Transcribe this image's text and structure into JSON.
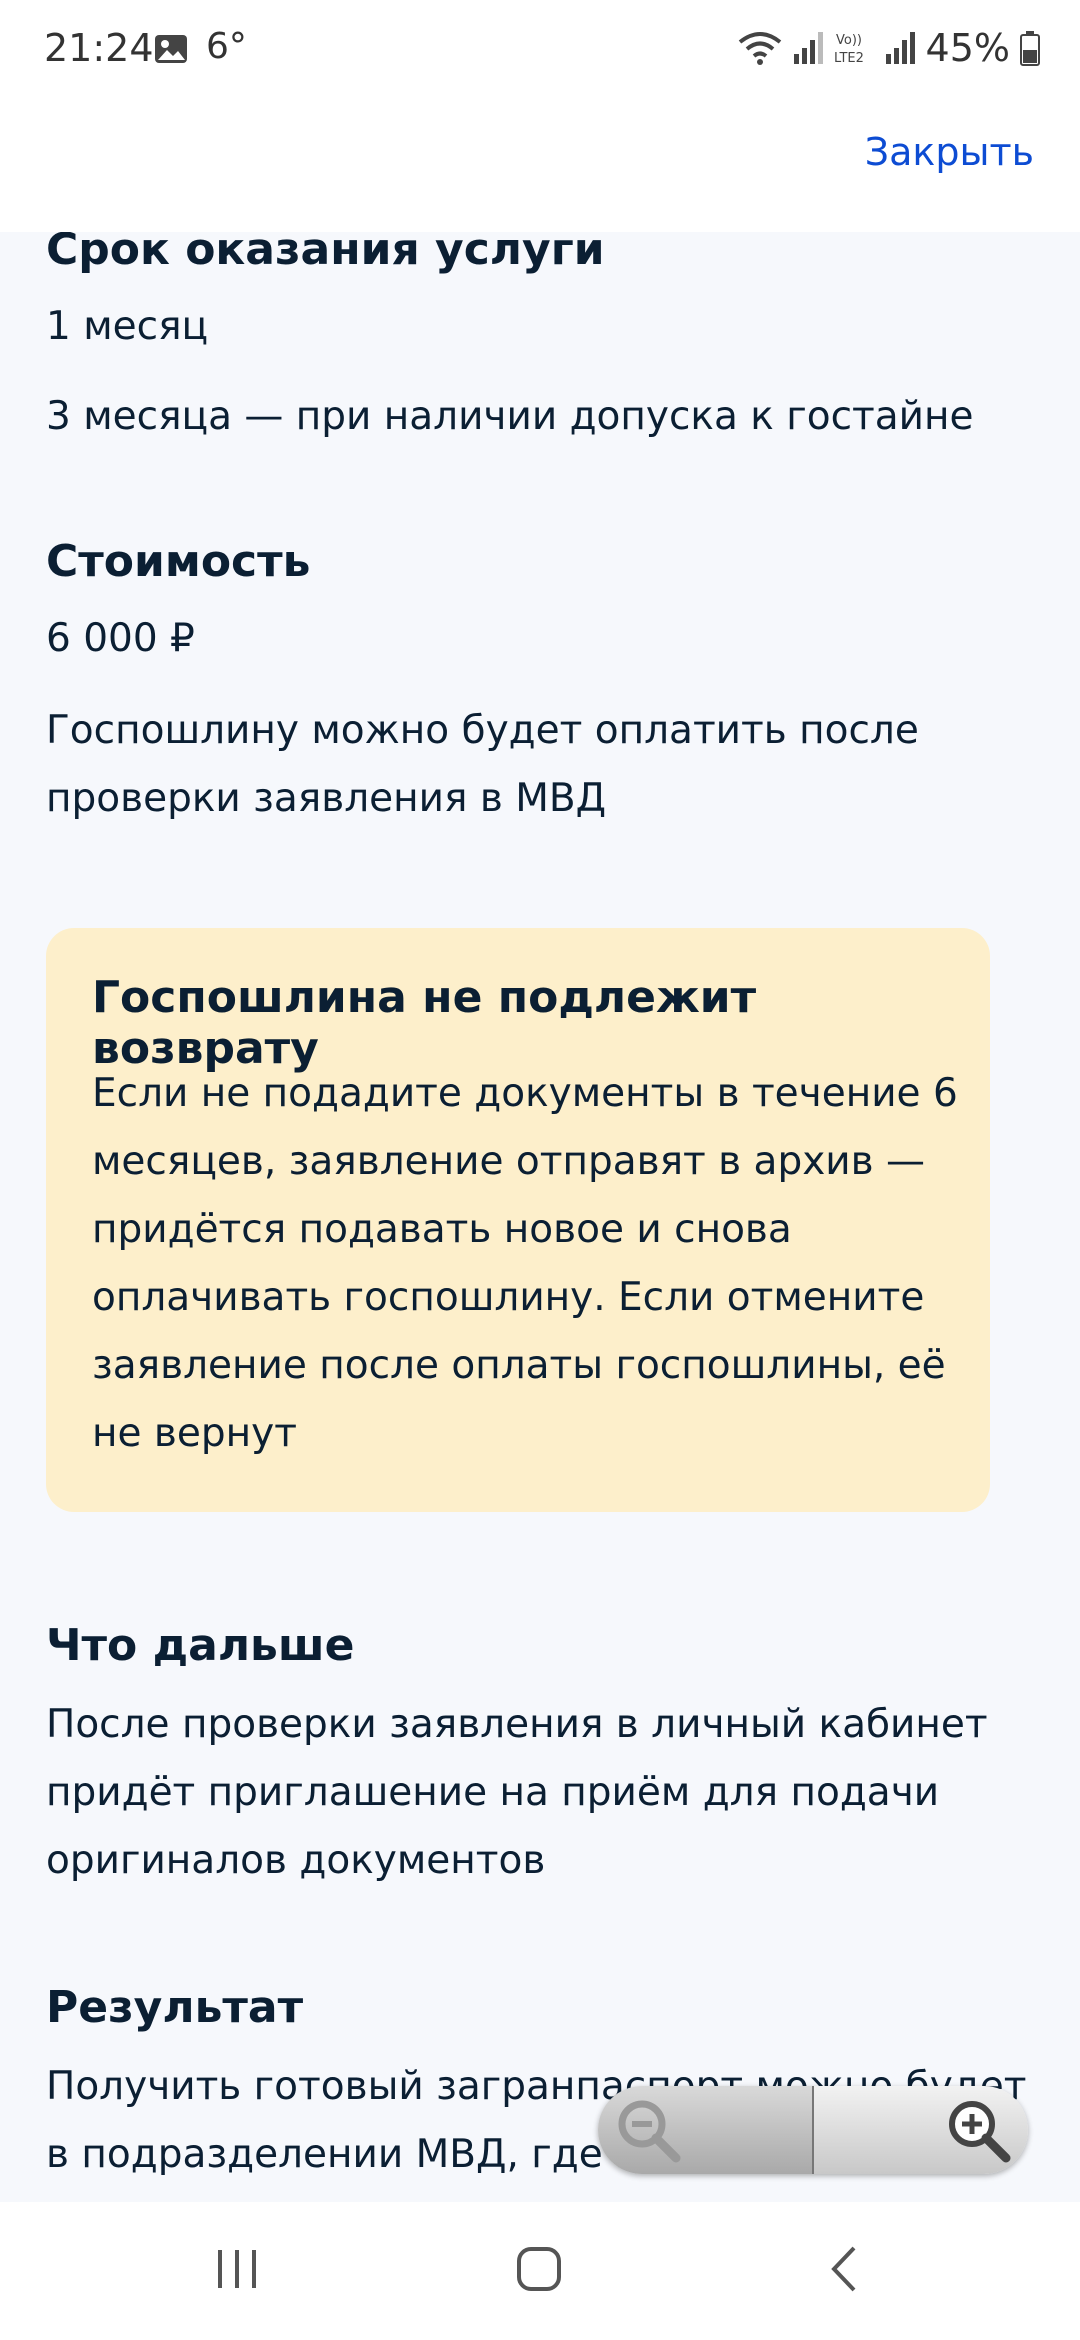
{
  "status_bar": {
    "time": "21:24",
    "temperature": "6°",
    "battery": "45%",
    "icons": [
      "photo-icon",
      "wifi-icon",
      "signal-icon",
      "volte-icon",
      "signal-icon",
      "battery-icon"
    ]
  },
  "header": {
    "close_label": "Закрыть"
  },
  "sections": {
    "term": {
      "title": "Срок оказания услуги",
      "line1": "1 месяц",
      "line2": "3 месяца — при наличии допуска к гостайне"
    },
    "cost": {
      "title": "Стоимость",
      "amount": "6 000 ₽",
      "note": "Госпошлину можно будет оплатить после проверки заявления в МВД"
    },
    "warning": {
      "title": "Госпошлина не подлежит возврату",
      "text": "Если не подадите документы в течение 6 месяцев, заявление отправят в архив — придётся подавать новое и снова оплачивать госпошлину. Если отмените заявление после оплаты госпошлины, её не вернут"
    },
    "next": {
      "title": "Что дальше",
      "text": "После проверки заявления в личный кабинет придёт приглашение на приём для подачи оригиналов документов"
    },
    "result": {
      "title": "Результат",
      "text": "Получить готовый загранпаспорт можно будет в подразделении МВД, где подавали документы. Уведомление о готовности придёт"
    }
  },
  "colors": {
    "accent": "#0d4cd3",
    "warning_bg": "#fdefcb",
    "page_bg": "#f6f8fc",
    "text": "#0b1f33"
  }
}
